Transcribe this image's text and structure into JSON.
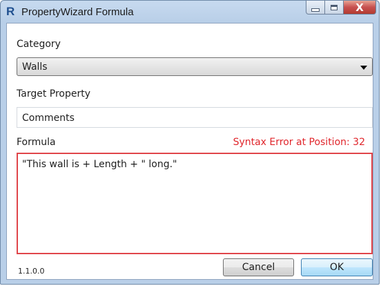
{
  "window": {
    "title": "PropertyWizard Formula",
    "app_icon_letter": "R",
    "close_glyph": "X"
  },
  "form": {
    "category_label": "Category",
    "category_value": "Walls",
    "target_label": "Target Property",
    "target_value": "Comments",
    "formula_label": "Formula",
    "error_message": "Syntax Error at Position: 32",
    "formula_value": "\"This wall is + Length + \" long.\""
  },
  "footer": {
    "version": "1.1.0.0",
    "cancel_label": "Cancel",
    "ok_label": "OK"
  },
  "colors": {
    "error": "#e0252b",
    "error_border": "#e0454a",
    "close_button": "#c75050",
    "ok_accent": "#3c7fb1"
  }
}
